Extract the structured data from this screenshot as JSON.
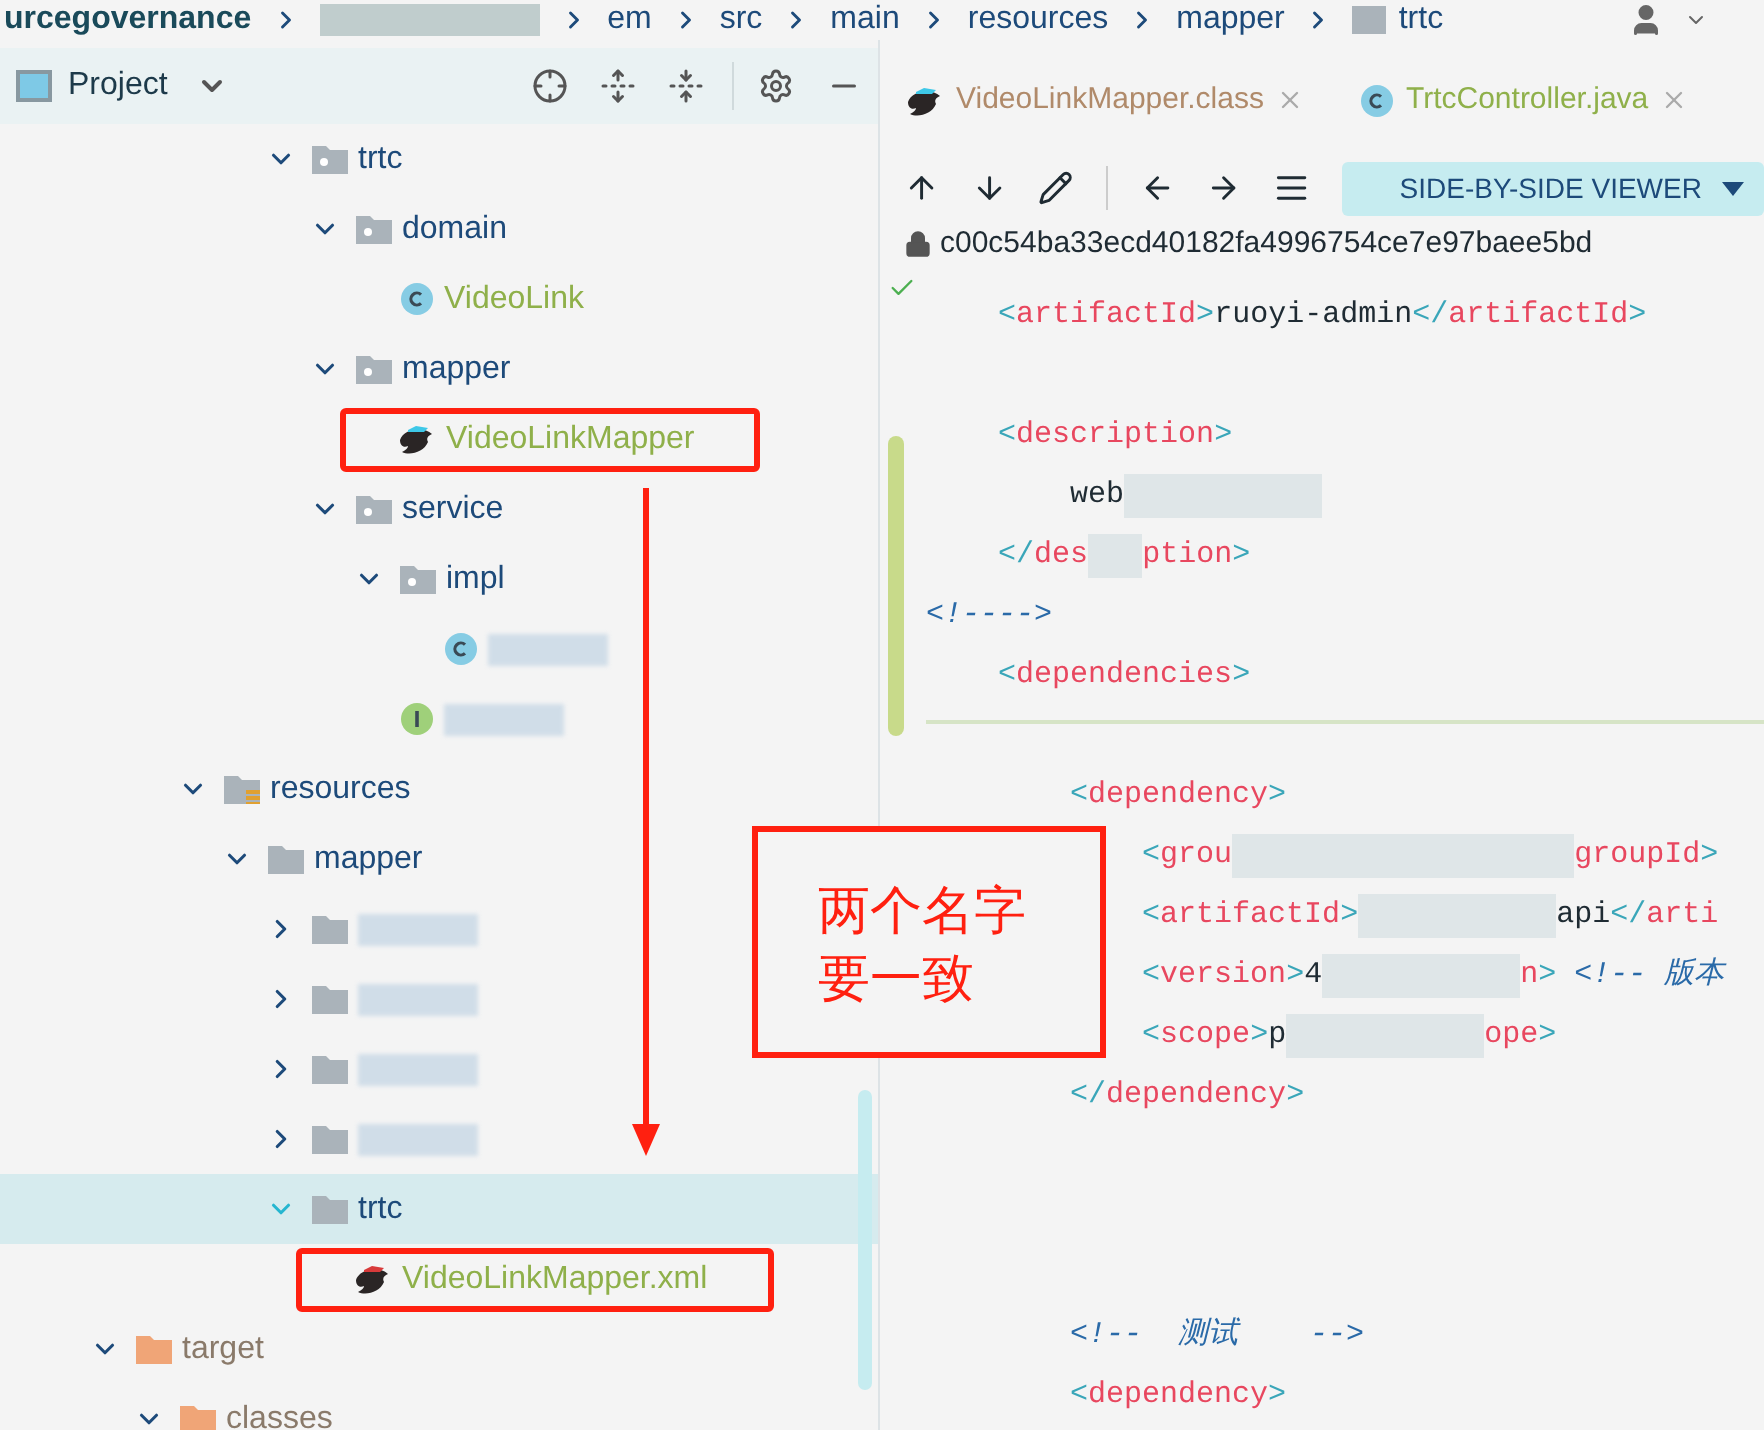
{
  "breadcrumb": [
    {
      "label": "urcegovernance",
      "kind": "module"
    },
    {
      "kind": "blurred"
    },
    {
      "label": "em",
      "kind": "plain"
    },
    {
      "label": "src",
      "kind": "plain"
    },
    {
      "label": "main",
      "kind": "plain"
    },
    {
      "label": "resources",
      "kind": "plain"
    },
    {
      "label": "mapper",
      "kind": "plain"
    },
    {
      "label": "trtc",
      "kind": "folder"
    }
  ],
  "project_panel": {
    "title": "Project",
    "tree": [
      {
        "children": [
          {
            "children": [
              {
                "children": [
                  {
                    "children": [
                      {
                        "label": "trtc",
                        "kind": "folder",
                        "expanded": true,
                        "selected": false,
                        "annotated": false,
                        "children": [
                          {
                            "label": "domain",
                            "kind": "folder",
                            "expanded": true,
                            "selected": false,
                            "annotated": false,
                            "children": [
                              {
                                "label": "VideoLink",
                                "kind": "class",
                                "selected": false,
                                "annotated": false
                              }
                            ]
                          },
                          {
                            "label": "mapper",
                            "kind": "folder",
                            "expanded": true,
                            "selected": false,
                            "annotated": false,
                            "children": [
                              {
                                "label": "VideoLinkMapper",
                                "kind": "mapper",
                                "selected": false,
                                "annotated": true
                              }
                            ]
                          },
                          {
                            "label": "service",
                            "kind": "folder",
                            "expanded": true,
                            "selected": false,
                            "annotated": false,
                            "children": [
                              {
                                "label": "impl",
                                "kind": "folder",
                                "expanded": true,
                                "selected": false,
                                "annotated": false,
                                "children": [
                                  {
                                    "kind": "class",
                                    "blurred": true,
                                    "selected": false,
                                    "annotated": false
                                  }
                                ]
                              },
                              {
                                "kind": "interface",
                                "blurred": true,
                                "selected": false,
                                "annotated": false
                              }
                            ]
                          }
                        ]
                      }
                    ]
                  }
                ]
              },
              {
                "label": "resources",
                "kind": "resource-folder",
                "expanded": true,
                "selected": false,
                "annotated": false,
                "children": [
                  {
                    "label": "mapper",
                    "kind": "plain-folder",
                    "expanded": true,
                    "selected": false,
                    "annotated": false,
                    "children": [
                      {
                        "kind": "plain-folder",
                        "blurred": true,
                        "expanded": false,
                        "selected": false,
                        "annotated": false
                      },
                      {
                        "kind": "plain-folder",
                        "blurred": true,
                        "expanded": false,
                        "selected": false,
                        "annotated": false
                      },
                      {
                        "kind": "plain-folder",
                        "blurred": true,
                        "expanded": false,
                        "selected": false,
                        "annotated": false
                      },
                      {
                        "kind": "plain-folder",
                        "blurred": true,
                        "expanded": false,
                        "selected": false,
                        "annotated": false
                      },
                      {
                        "label": "trtc",
                        "kind": "plain-folder",
                        "expanded": true,
                        "selected": true,
                        "annotated": false,
                        "children": [
                          {
                            "label": "VideoLinkMapper.xml",
                            "kind": "xml-mapper",
                            "selected": false,
                            "annotated": true
                          }
                        ]
                      }
                    ]
                  }
                ]
              }
            ]
          }
        ]
      },
      {
        "label": "target",
        "kind": "excluded-folder",
        "expanded": true,
        "selected": false,
        "annotated": false,
        "children": [
          {
            "label": "classes",
            "kind": "excluded-folder",
            "expanded": true,
            "selected": false,
            "annotated": false
          }
        ]
      }
    ]
  },
  "editor": {
    "tabs": [
      {
        "label": "VideoLinkMapper.class",
        "kind": "mapper",
        "selected": false
      },
      {
        "label": "TrtcController.java",
        "kind": "class",
        "selected": false
      }
    ],
    "viewer_mode": "SIDE-BY-SIDE VIEWER",
    "revision": "c00c54ba33ecd40182fa4996754ce7e97baee5bd",
    "lines": [
      {
        "kind": "code",
        "tokens": [
          {
            "kind": "tag",
            "text": "    <artifactId>"
          },
          {
            "kind": "text",
            "text": "ruoyi-admin"
          },
          {
            "kind": "tag",
            "text": "</artifactId>"
          }
        ]
      },
      {
        "kind": "blank"
      },
      {
        "kind": "code",
        "tokens": [
          {
            "kind": "tag",
            "text": "    <description>"
          }
        ]
      },
      {
        "kind": "code",
        "tokens": [
          {
            "kind": "text",
            "text": "        web"
          },
          {
            "kind": "blur-long"
          }
        ]
      },
      {
        "kind": "code",
        "tokens": [
          {
            "kind": "tag",
            "text": "    </des"
          },
          {
            "kind": "blur-short"
          },
          {
            "kind": "tag",
            "text": "ption>"
          }
        ]
      },
      {
        "kind": "code",
        "tokens": [
          {
            "kind": "comment",
            "text": "<!---->"
          }
        ]
      },
      {
        "kind": "code",
        "tokens": [
          {
            "kind": "tag",
            "text": "    <dependencies>"
          }
        ]
      },
      {
        "kind": "divider"
      },
      {
        "kind": "code",
        "tokens": [
          {
            "kind": "tag",
            "text": "        <dependency>"
          }
        ]
      },
      {
        "kind": "code",
        "tokens": [
          {
            "kind": "tag",
            "text": "            <grou"
          },
          {
            "kind": "blur-wide"
          },
          {
            "kind": "tag",
            "text": "groupId>"
          }
        ]
      },
      {
        "kind": "code",
        "tokens": [
          {
            "kind": "tag",
            "text": "            <artifactId>"
          },
          {
            "kind": "blur-long"
          },
          {
            "kind": "text",
            "text": "api"
          },
          {
            "kind": "tag",
            "text": "</arti"
          }
        ]
      },
      {
        "kind": "code",
        "tokens": [
          {
            "kind": "tag",
            "text": "            <version>"
          },
          {
            "kind": "text",
            "text": "4"
          },
          {
            "kind": "blur-long"
          },
          {
            "kind": "tag",
            "text": "n>"
          },
          {
            "kind": "comment",
            "text": " <!-- 版本"
          }
        ]
      },
      {
        "kind": "code",
        "tokens": [
          {
            "kind": "tag",
            "text": "            <scope>"
          },
          {
            "kind": "text",
            "text": "p"
          },
          {
            "kind": "blur-long"
          },
          {
            "kind": "tag",
            "text": "ope>"
          }
        ]
      },
      {
        "kind": "code",
        "tokens": [
          {
            "kind": "tag",
            "text": "        </dependency>"
          }
        ]
      },
      {
        "kind": "blank"
      },
      {
        "kind": "blank"
      },
      {
        "kind": "blank"
      },
      {
        "kind": "code",
        "tokens": [
          {
            "kind": "comment",
            "text": "        <!--  测试    -->"
          }
        ]
      },
      {
        "kind": "code",
        "tokens": [
          {
            "kind": "tag",
            "text": "        <dependency>"
          }
        ]
      }
    ]
  },
  "annotation": {
    "note": "两个名字要一致"
  }
}
